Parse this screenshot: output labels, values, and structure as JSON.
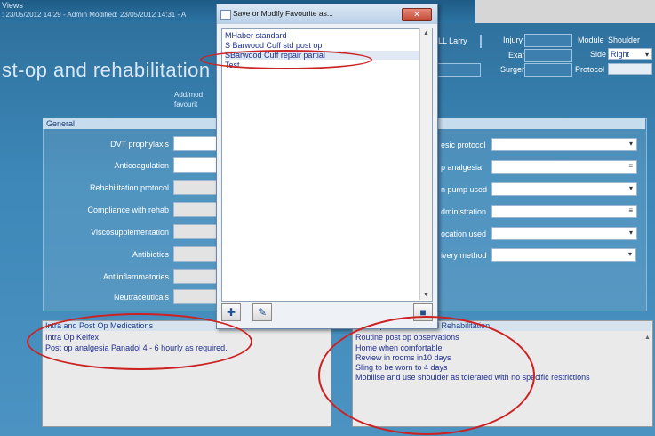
{
  "app": {
    "menu_views": "Views",
    "meta_line": ": 23/05/2012 14:29 - Admin Modified: 23/05/2012 14:31 - A",
    "page_title": "st-op and rehabilitation",
    "addmod_line1": "Add/mod",
    "addmod_line2": "favourit"
  },
  "header": {
    "patient_name": "LL Larry",
    "injury_label": "Injury",
    "exam_label": "Exam",
    "surgery_label": "Surgery",
    "module_label": "Module",
    "module_value": "Shoulder",
    "side_label": "Side",
    "side_value": "Right",
    "protocol_label": "Protocol"
  },
  "general": {
    "title": "General",
    "left_labels": [
      "DVT prophylaxis",
      "Anticoagulation",
      "Rehabilitation protocol",
      "Compliance with rehab",
      "Viscosupplementation",
      "Antibiotics",
      "Antiinflammatories",
      "Neutraceuticals"
    ],
    "right_labels": [
      "esic protocol",
      "p analgesia",
      "n pump used",
      "dministration",
      "ocation used",
      "ivery method"
    ]
  },
  "meds_panel": {
    "title": "Intra and Post Op Medications",
    "lines": [
      "Intra Op Kelfex",
      "Post op analgesia Panadol 4 - 6  hourly as required."
    ]
  },
  "rehab_panel": {
    "title": "Post Op Instruction and Rehabilitation",
    "lines": [
      "Routine post op observations",
      "Home when comfortable",
      "Review in rooms in10 days",
      "Sling to be worn to 4 days",
      "Mobilise and use shoulder as tolerated with no specific restrictions"
    ]
  },
  "dialog": {
    "title": "Save or Modify Favourite as...",
    "close_label": "✕",
    "items": [
      "MHaber standard",
      "S Barwood Cuff std post op",
      "SBarwood Cuff repair partial",
      "Test"
    ],
    "selected_index": 2
  },
  "icons": {
    "add": "plus-icon",
    "edit": "pencil-icon",
    "delete": "trash-icon"
  },
  "colors": {
    "background_blue": "#3c87b8",
    "annotation_red": "#cc2222",
    "list_text": "#1d2e8f"
  }
}
